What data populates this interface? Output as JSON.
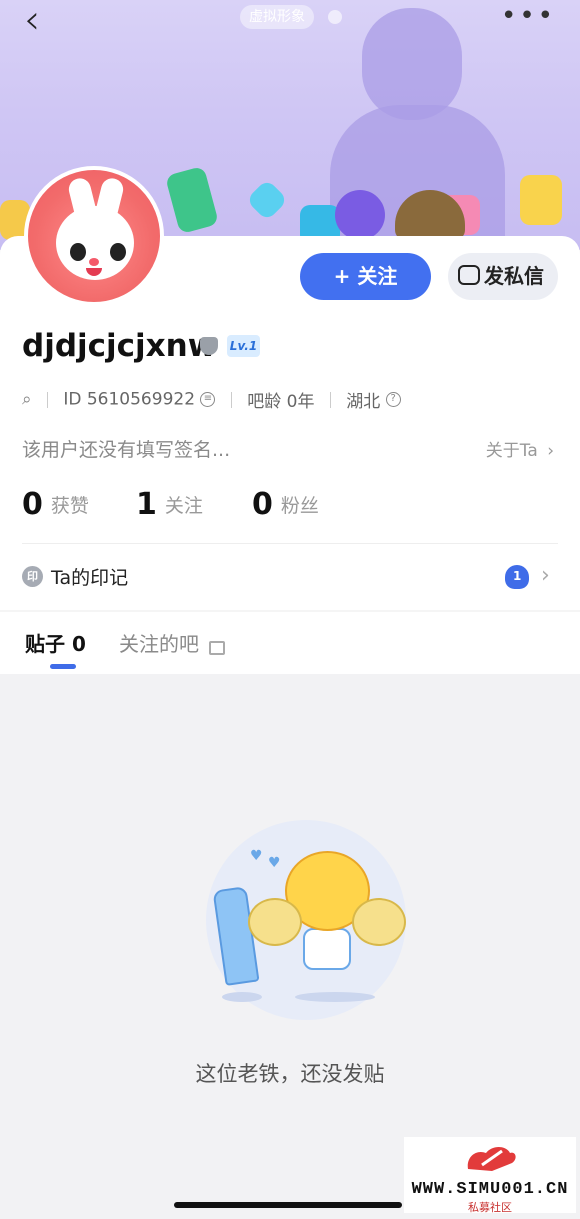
{
  "header": {
    "virtual_avatar_label": "虚拟形象"
  },
  "profile": {
    "username": "djdjcjcjxnw",
    "level": "Lv.1",
    "id_text": "ID 5610569922",
    "age_text": "吧龄 0年",
    "location": "湖北",
    "signature": "该用户还没有填写签名...",
    "about_label": "关于Ta"
  },
  "actions": {
    "follow_label": "+ 关注",
    "message_label": "发私信"
  },
  "stats": [
    {
      "value": "0",
      "label": "获赞"
    },
    {
      "value": "1",
      "label": "关注"
    },
    {
      "value": "0",
      "label": "粉丝"
    }
  ],
  "imprint": {
    "icon_char": "印",
    "label": "Ta的印记"
  },
  "tabs": [
    {
      "label": "贴子 0",
      "active": true
    },
    {
      "label": "关注的吧",
      "active": false
    }
  ],
  "empty_state": {
    "message": "这位老铁，还没发贴"
  },
  "watermark": {
    "text": "WWW.SIMU001.CN",
    "sub": "私募社区"
  },
  "colors": {
    "accent": "#4270f0",
    "banner": "#cfc6f4"
  }
}
